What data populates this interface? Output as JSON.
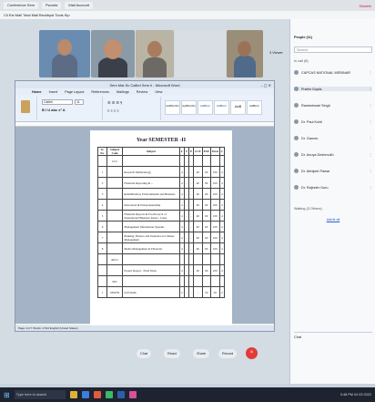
{
  "browser": {
    "tabs": [
      "Conference Sem",
      "Pwords",
      "Mail Account"
    ],
    "url": "Cli Est Mail Total Mall Beckbyst Tools Kip",
    "profile_label": "Disable"
  },
  "meeting": {
    "tiles": [
      {
        "name": ""
      },
      {
        "name": ""
      },
      {
        "name": ""
      },
      {
        "name": ""
      },
      {
        "name": ""
      }
    ],
    "more_label": "3 Viewer"
  },
  "word": {
    "title": "Sem Mat Sc Calibri Sem Ii - Microsoft Word",
    "tabs": [
      "Home",
      "Insert",
      "Page Layout",
      "References",
      "Mailings",
      "Review",
      "View"
    ],
    "styles": [
      "AaBbCcDc",
      "AaBbCcDc",
      "AaBbCc",
      "AaBbCc",
      "AaB",
      "AaBbCc"
    ],
    "font_name": "Calibri",
    "font_size": "11",
    "status": "Page 4 of 7   Words: 2,514   English (United States)",
    "doc_title": "Year SEMESTER -II",
    "table": {
      "headers": [
        "Sr. No.",
        "Subject Code",
        "Subject",
        "L",
        "T",
        "P",
        "CCE",
        "ESE",
        "Total",
        "C"
      ],
      "rows": [
        [
          "",
          "CCC",
          "",
          "",
          "",
          "",
          "",
          "",
          "",
          ""
        ],
        [
          "1",
          "",
          "Research Methodology",
          "4",
          "-",
          "-",
          "40",
          "60",
          "100",
          "4"
        ],
        [
          "2",
          "",
          "Financial Reporting & ...",
          "4",
          "-",
          "-",
          "40",
          "60",
          "100",
          "4"
        ],
        [
          "3",
          "",
          "Rehabilitation, Environmental and Business",
          "4",
          "-",
          "-",
          "40",
          "60",
          "100",
          "4"
        ],
        [
          "4",
          "",
          "Innovation & Entrepreneurship",
          "4",
          "-",
          "-",
          "40",
          "60",
          "100",
          "4"
        ],
        [
          "5",
          "",
          "Financial Reports & Pro-Protocol of International Business Issues / Cases",
          "4",
          "-",
          "-",
          "40",
          "60",
          "100",
          "4"
        ],
        [
          "6",
          "",
          "Management Information Systems",
          "4",
          "-",
          "-",
          "40",
          "60",
          "100",
          "4"
        ],
        [
          "7",
          "",
          "Banking, Finance and Insurance in Climate Management",
          "4",
          "-",
          "-",
          "40",
          "60",
          "100",
          "4"
        ],
        [
          "8",
          "",
          "Media Management in Financial",
          "4",
          "-",
          "-",
          "40",
          "60",
          "100",
          "4"
        ],
        [
          "",
          "AECC",
          "",
          "",
          "",
          "",
          "",
          "",
          "",
          ""
        ],
        [
          "",
          "",
          "Project Report - Field Work",
          "4",
          "-",
          "-",
          "40",
          "60",
          "100",
          "4"
        ],
        [
          "",
          "SEC",
          "",
          "",
          "",
          "",
          "",
          "",
          "",
          ""
        ],
        [
          "1",
          "MSESS",
          "Soft Skills",
          "2",
          "-",
          "-",
          "-",
          "50",
          "50",
          "2"
        ]
      ]
    }
  },
  "side_panel": {
    "title": "People (11)",
    "search_placeholder": "Search",
    "section": "In call (8)",
    "participants": [
      "CAPCAS NATIONAL WEBINAR",
      "Pratim Gupta",
      "Rameshwari Singh",
      "Dr. Paul Kohli",
      "Dr. Gaurav",
      "Dr. Anuya Deshmukh",
      "Dr. Abhijeet Pawar",
      "Dr. Rajinder Guru"
    ],
    "waiting_section": "Waiting (3 Others)",
    "link": "Admit all",
    "footer": "Chat"
  },
  "controls": {
    "buttons": [
      "Chat",
      "React",
      "Share",
      "Record"
    ],
    "leave": "×"
  },
  "taskbar": {
    "search": "Type here to search",
    "tray": "3:48 PM  04 03 2022"
  },
  "colors": {
    "leave": "#e23a3a",
    "ribbon": "#eaf1fa",
    "taskbar": "#1d2330"
  }
}
